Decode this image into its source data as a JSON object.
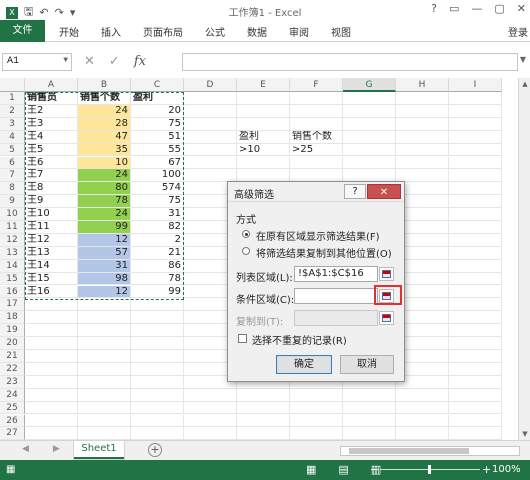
{
  "window": {
    "title": "工作簿1 - Excel",
    "buttons": [
      "?",
      "▭",
      "—",
      "▢",
      "✕"
    ]
  },
  "ribbon": {
    "file_tab": "文件",
    "tabs": [
      "开始",
      "插入",
      "页面布局",
      "公式",
      "数据",
      "审阅",
      "视图"
    ],
    "login": "登录"
  },
  "formula_bar": {
    "name_box": "A1",
    "formula": ""
  },
  "columns": [
    "A",
    "B",
    "C",
    "D",
    "E",
    "F",
    "G",
    "H",
    "I"
  ],
  "selected_column": "G",
  "rows": [
    {
      "n": "1",
      "a": "销售员",
      "b": "销售个数",
      "c": "盈利",
      "e": "",
      "f": ""
    },
    {
      "n": "2",
      "a": "王2",
      "b": "24",
      "c": "20",
      "e": "",
      "f": ""
    },
    {
      "n": "3",
      "a": "王3",
      "b": "28",
      "c": "75",
      "e": "",
      "f": ""
    },
    {
      "n": "4",
      "a": "王4",
      "b": "47",
      "c": "51",
      "e": "盈利",
      "f": "销售个数"
    },
    {
      "n": "5",
      "a": "王5",
      "b": "35",
      "c": "55",
      "e": ">10",
      "f": ">25"
    },
    {
      "n": "6",
      "a": "王6",
      "b": "10",
      "c": "67",
      "e": "",
      "f": ""
    },
    {
      "n": "7",
      "a": "王7",
      "b": "24",
      "c": "100",
      "e": "",
      "f": ""
    },
    {
      "n": "8",
      "a": "王8",
      "b": "80",
      "c": "574",
      "e": "",
      "f": ""
    },
    {
      "n": "9",
      "a": "王9",
      "b": "78",
      "c": "75",
      "e": "",
      "f": ""
    },
    {
      "n": "10",
      "a": "王10",
      "b": "24",
      "c": "31",
      "e": "",
      "f": ""
    },
    {
      "n": "11",
      "a": "王11",
      "b": "99",
      "c": "82",
      "e": "",
      "f": ""
    },
    {
      "n": "12",
      "a": "王12",
      "b": "12",
      "c": "2",
      "e": "",
      "f": ""
    },
    {
      "n": "13",
      "a": "王13",
      "b": "57",
      "c": "21",
      "e": "",
      "f": ""
    },
    {
      "n": "14",
      "a": "王14",
      "b": "31",
      "c": "86",
      "e": "",
      "f": ""
    },
    {
      "n": "15",
      "a": "王15",
      "b": "98",
      "c": "78",
      "e": "",
      "f": ""
    },
    {
      "n": "16",
      "a": "王16",
      "b": "12",
      "c": "99",
      "e": "",
      "f": ""
    },
    {
      "n": "17",
      "a": "",
      "b": "",
      "c": "",
      "e": "",
      "f": ""
    },
    {
      "n": "18",
      "a": "",
      "b": "",
      "c": "",
      "e": "",
      "f": ""
    },
    {
      "n": "19",
      "a": "",
      "b": "",
      "c": "",
      "e": "",
      "f": ""
    },
    {
      "n": "20",
      "a": "",
      "b": "",
      "c": "",
      "e": "",
      "f": ""
    },
    {
      "n": "21",
      "a": "",
      "b": "",
      "c": "",
      "e": "",
      "f": ""
    },
    {
      "n": "22",
      "a": "",
      "b": "",
      "c": "",
      "e": "",
      "f": ""
    },
    {
      "n": "23",
      "a": "",
      "b": "",
      "c": "",
      "e": "",
      "f": ""
    },
    {
      "n": "24",
      "a": "",
      "b": "",
      "c": "",
      "e": "",
      "f": ""
    },
    {
      "n": "25",
      "a": "",
      "b": "",
      "c": "",
      "e": "",
      "f": ""
    },
    {
      "n": "26",
      "a": "",
      "b": "",
      "c": "",
      "e": "",
      "f": ""
    },
    {
      "n": "27",
      "a": "",
      "b": "",
      "c": "",
      "e": "",
      "f": ""
    }
  ],
  "fill_colors": {
    "yellow": "#ffe699",
    "green": "#92d050",
    "blue": "#b4c6e7"
  },
  "sheet": {
    "tab": "Sheet1"
  },
  "status": {
    "zoom": "100%"
  },
  "dialog": {
    "title": "高级筛选",
    "section": "方式",
    "option1": "在原有区域显示筛选结果(F)",
    "option2": "将筛选结果复制到其他位置(O)",
    "list_label": "列表区域(L):",
    "list_value": "!$A$1:$C$16",
    "criteria_label": "条件区域(C):",
    "criteria_value": "",
    "copy_label": "复制到(T):",
    "copy_value": "",
    "unique_label": "选择不重复的记录(R)",
    "ok": "确定",
    "cancel": "取消"
  }
}
